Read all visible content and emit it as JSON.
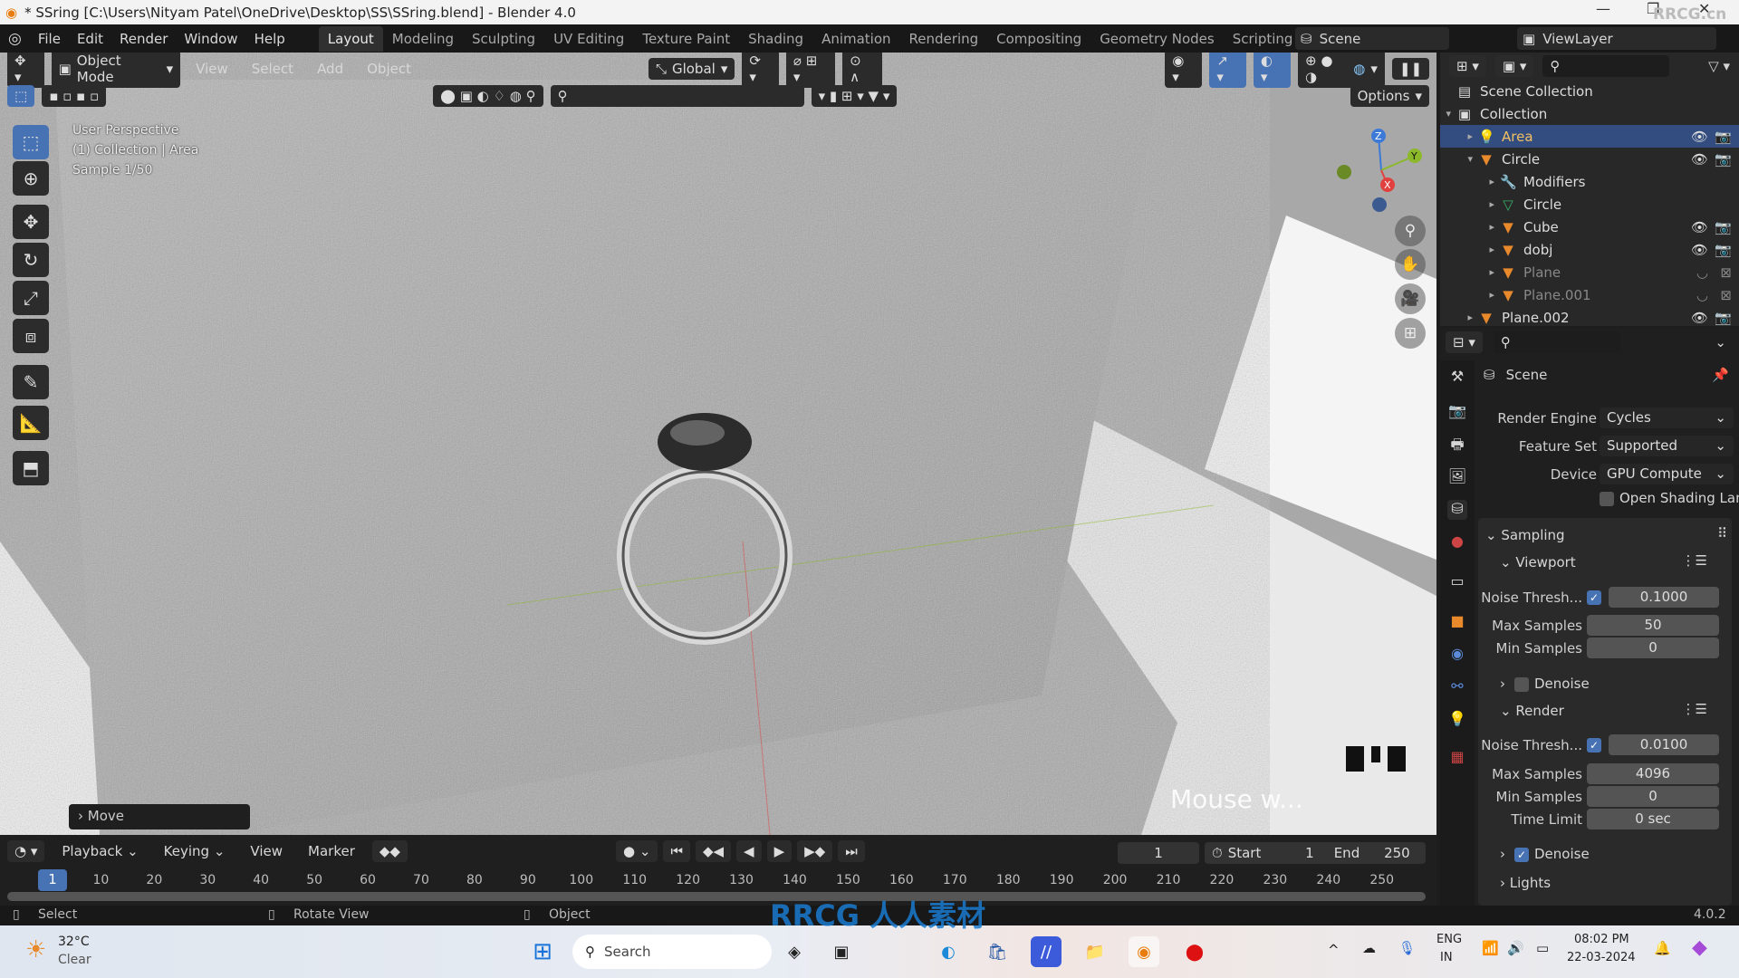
{
  "window": {
    "title": "* SSring [C:\\Users\\Nityam Patel\\OneDrive\\Desktop\\SS\\SSring.blend] - Blender 4.0",
    "minimize": "—",
    "restore": "❐",
    "close": "✕",
    "watermark": "RRCG.cn"
  },
  "menu": {
    "items": [
      "File",
      "Edit",
      "Render",
      "Window",
      "Help"
    ],
    "workspaces": [
      "Layout",
      "Modeling",
      "Sculpting",
      "UV Editing",
      "Texture Paint",
      "Shading",
      "Animation",
      "Rendering",
      "Compositing",
      "Geometry Nodes",
      "Scripting"
    ],
    "active_workspace": "Layout",
    "add_workspace": "+",
    "scene_label": "Scene",
    "viewlayer_label": "ViewLayer"
  },
  "viewport": {
    "mode": "Object Mode",
    "menus": [
      "View",
      "Select",
      "Add",
      "Object"
    ],
    "transform_orientation": "Global",
    "options_label": "Options",
    "overlay_lines": [
      "User Perspective",
      "(1) Collection | Area",
      "Sample 1/50"
    ],
    "operator_panel": "Move",
    "caption": "Mouse w...",
    "gizmo": {
      "z": "Z",
      "y": "Y",
      "x": "X"
    },
    "colors": {
      "accent": "#4772b3",
      "x_axis": "#e0413f",
      "y_axis": "#8bb92b",
      "z_axis": "#3d7ad8"
    }
  },
  "outliner": {
    "rows": [
      {
        "name": "Scene Collection",
        "icon": "scene-collection-icon",
        "depth": 0
      },
      {
        "name": "Collection",
        "icon": "collection-icon",
        "depth": 0,
        "expanded": true
      },
      {
        "name": "Area",
        "icon": "area-light-icon",
        "depth": 1,
        "selected": true,
        "visible": true
      },
      {
        "name": "Circle",
        "icon": "mesh-object-icon",
        "depth": 1,
        "expanded": true,
        "visible": true
      },
      {
        "name": "Modifiers",
        "icon": "wrench-icon",
        "depth": 2
      },
      {
        "name": "Circle",
        "icon": "mesh-data-icon",
        "depth": 2
      },
      {
        "name": "Cube",
        "icon": "mesh-object-icon",
        "depth": 2,
        "visible": true
      },
      {
        "name": "dobj",
        "icon": "mesh-object-icon",
        "depth": 2,
        "visible": true
      },
      {
        "name": "Plane",
        "icon": "mesh-object-icon",
        "depth": 2,
        "hidden": true
      },
      {
        "name": "Plane.001",
        "icon": "mesh-object-icon",
        "depth": 2,
        "hidden": true
      },
      {
        "name": "Plane.002",
        "icon": "mesh-object-icon",
        "depth": 1,
        "visible": true
      }
    ]
  },
  "properties": {
    "context": "Scene",
    "render_engine": {
      "label": "Render Engine",
      "value": "Cycles"
    },
    "feature_set": {
      "label": "Feature Set",
      "value": "Supported"
    },
    "device": {
      "label": "Device",
      "value": "GPU Compute"
    },
    "osl": {
      "label": "Open Shading Lan...",
      "checked": false
    },
    "sampling": {
      "title": "Sampling",
      "viewport": {
        "title": "Viewport",
        "noise_label": "Noise Thresh...",
        "noise_checked": true,
        "noise": "0.1000",
        "max_label": "Max Samples",
        "max": "50",
        "min_label": "Min Samples",
        "min": "0",
        "denoise_label": "Denoise",
        "denoise": false
      },
      "render": {
        "title": "Render",
        "noise_label": "Noise Thresh...",
        "noise_checked": true,
        "noise": "0.0100",
        "max_label": "Max Samples",
        "max": "4096",
        "min_label": "Min Samples",
        "min": "0",
        "time_label": "Time Limit",
        "time": "0 sec",
        "denoise_label": "Denoise",
        "denoise": true
      }
    },
    "lights": "Lights"
  },
  "timeline": {
    "menus": [
      "Playback",
      "Keying",
      "View",
      "Marker"
    ],
    "current_frame": "1",
    "start_label": "Start",
    "start": "1",
    "end_label": "End",
    "end": "250",
    "ticks": [
      "10",
      "20",
      "30",
      "40",
      "50",
      "60",
      "70",
      "80",
      "90",
      "100",
      "110",
      "120",
      "130",
      "140",
      "150",
      "160",
      "170",
      "180",
      "190",
      "200",
      "210",
      "220",
      "230",
      "240",
      "250"
    ]
  },
  "statusbar": {
    "select": "Select",
    "rotate": "Rotate View",
    "object": "Object",
    "version": "4.0.2"
  },
  "taskbar": {
    "temp": "32°C",
    "weather": "Clear",
    "search": "Search",
    "lang1": "ENG",
    "lang2": "IN",
    "time": "08:02 PM",
    "date": "22-03-2024",
    "watermark_text": "RRCG 人人素材"
  }
}
